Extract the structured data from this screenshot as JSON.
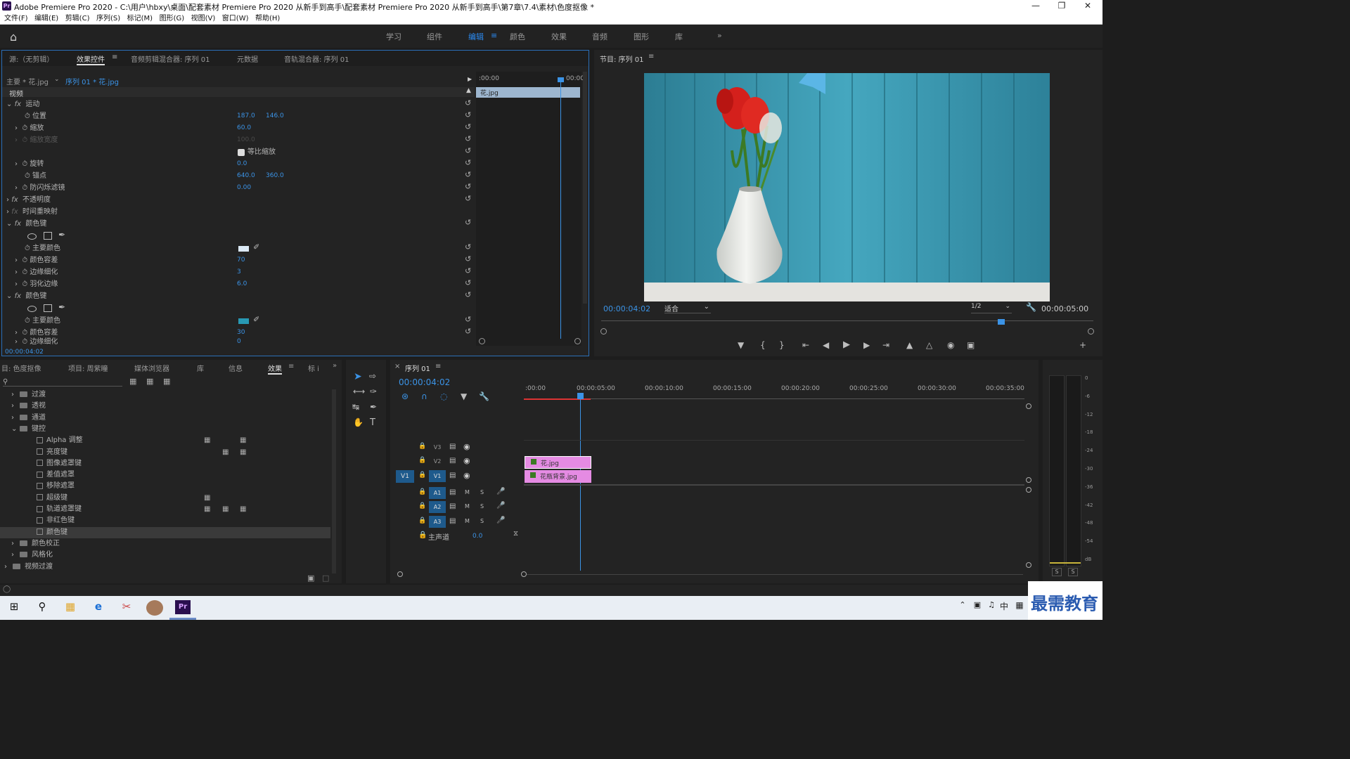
{
  "window": {
    "title": "Adobe Premiere Pro 2020 - C:\\用户\\hbxy\\桌面\\配套素材 Premiere Pro 2020 从新手到高手\\配套素材 Premiere Pro 2020 从新手到高手\\第7章\\7.4\\素材\\色度抠像 *",
    "logo": "Pr"
  },
  "menu": [
    "文件(F)",
    "编辑(E)",
    "剪辑(C)",
    "序列(S)",
    "标记(M)",
    "图形(G)",
    "视图(V)",
    "窗口(W)",
    "帮助(H)"
  ],
  "workspaces": [
    "学习",
    "组件",
    "编辑",
    "颜色",
    "效果",
    "音频",
    "图形",
    "库"
  ],
  "effect_controls": {
    "tabs": [
      "源:（无剪辑）",
      "效果控件",
      "音频剪辑混合器: 序列 01",
      "元数据",
      "音轨混合器: 序列 01"
    ],
    "master": "主要 * 花.jpg",
    "sequence_clip": "序列 01 * 花.jpg",
    "time_start": ":00:00",
    "time_end": "00:00",
    "clip_label": "花.jpg",
    "video_header": "视频",
    "motion": "运动",
    "position": "位置",
    "pos_x": "187.0",
    "pos_y": "146.0",
    "scale": "缩放",
    "scale_val": "60.0",
    "scale_width": "缩放宽度",
    "scale_width_val": "100.0",
    "uniform": "等比缩放",
    "rotation": "旋转",
    "rotation_val": "0.0",
    "anchor": "锚点",
    "anchor_x": "640.0",
    "anchor_y": "360.0",
    "flicker": "防闪烁滤镜",
    "flicker_val": "0.00",
    "opacity": "不透明度",
    "time_remap": "时间重映射",
    "colorkey1": "颜色键",
    "key_color": "主要颜色",
    "tolerance": "颜色容差",
    "tol1": "70",
    "edge_thin": "边缘细化",
    "edge1": "3",
    "feather": "羽化边缘",
    "feather1": "6.0",
    "colorkey2": "颜色键",
    "tol2": "30",
    "partial": "边缘细化",
    "partial_val": "0",
    "timecode": "00:00:04:02"
  },
  "program": {
    "title": "节目: 序列 01",
    "timecode": "00:00:04:02",
    "fit": "适合",
    "resolution": "1/2",
    "duration": "00:00:05:00"
  },
  "project": {
    "tabs": [
      "目: 色度抠像",
      "项目: 周紫瞳",
      "媒体浏览器",
      "库",
      "信息",
      "效果",
      "标 i"
    ],
    "items": [
      {
        "label": "过渡",
        "type": "folder",
        "level": 1
      },
      {
        "label": "透视",
        "type": "folder",
        "level": 1
      },
      {
        "label": "通道",
        "type": "folder",
        "level": 1
      },
      {
        "label": "键控",
        "type": "folder",
        "level": 1,
        "open": true
      },
      {
        "label": "Alpha 调整",
        "type": "fx",
        "level": 2
      },
      {
        "label": "亮度键",
        "type": "fx",
        "level": 2
      },
      {
        "label": "图像遮罩键",
        "type": "fx",
        "level": 2
      },
      {
        "label": "差值遮罩",
        "type": "fx",
        "level": 2
      },
      {
        "label": "移除遮罩",
        "type": "fx",
        "level": 2
      },
      {
        "label": "超级键",
        "type": "fx",
        "level": 2
      },
      {
        "label": "轨道遮罩键",
        "type": "fx",
        "level": 2
      },
      {
        "label": "非红色键",
        "type": "fx",
        "level": 2
      },
      {
        "label": "颜色键",
        "type": "fx",
        "level": 2,
        "selected": true
      },
      {
        "label": "颜色校正",
        "type": "folder",
        "level": 1
      },
      {
        "label": "风格化",
        "type": "folder",
        "level": 1
      },
      {
        "label": "视频过渡",
        "type": "folder",
        "level": 0
      }
    ]
  },
  "timeline": {
    "tab": "序列 01",
    "timecode": "00:00:04:02",
    "ruler": [
      ":00:00",
      "00:00:05:00",
      "00:00:10:00",
      "00:00:15:00",
      "00:00:20:00",
      "00:00:25:00",
      "00:00:30:00",
      "00:00:35:00"
    ],
    "tracks": [
      "V3",
      "V2",
      "V1",
      "A1",
      "A2",
      "A3"
    ],
    "src_patch": "V1",
    "mute": "M",
    "solo": "S",
    "master": "主声道",
    "master_val": "0.0",
    "clip_v2": "花.jpg",
    "clip_v1": "花瓶背景.jpg"
  },
  "meter": {
    "labels": [
      "0",
      "-6",
      "-12",
      "-18",
      "-24",
      "-30",
      "-36",
      "-42",
      "-48",
      "-54",
      "dB"
    ],
    "solo": "S"
  },
  "watermark": "最需教育",
  "tray": {
    "ime": "中"
  }
}
